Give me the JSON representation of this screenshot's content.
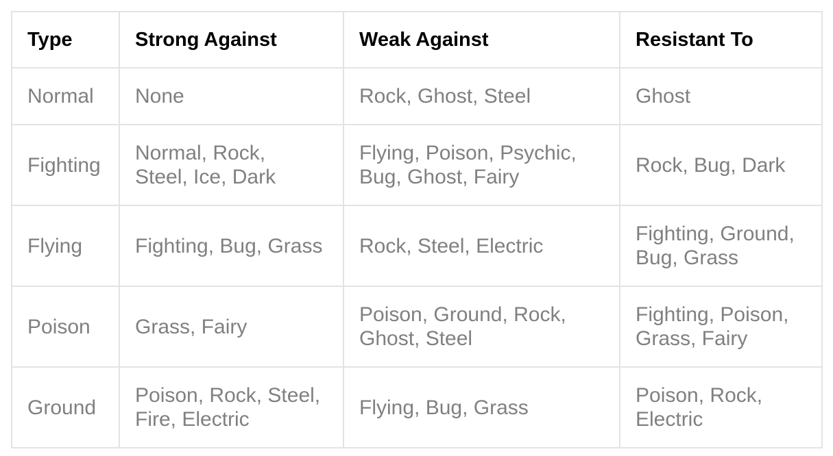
{
  "table": {
    "headers": [
      "Type",
      "Strong Against",
      "Weak Against",
      "Resistant To"
    ],
    "rows": [
      {
        "type": "Normal",
        "strong": [
          "None"
        ],
        "weak": [
          "Rock, Ghost, Steel"
        ],
        "resistant": [
          "Ghost"
        ]
      },
      {
        "type": "Fighting",
        "strong": [
          "Normal, Rock,",
          "Steel, Ice, Dark"
        ],
        "weak": [
          "Flying, Poison, Psychic,",
          "Bug, Ghost, Fairy"
        ],
        "resistant": [
          "Rock, Bug, Dark"
        ]
      },
      {
        "type": "Flying",
        "strong": [
          "Fighting, Bug, Grass"
        ],
        "weak": [
          "Rock, Steel, Electric"
        ],
        "resistant": [
          "Fighting, Ground,",
          "Bug, Grass"
        ]
      },
      {
        "type": "Poison",
        "strong": [
          "Grass, Fairy"
        ],
        "weak": [
          "Poison, Ground, Rock,",
          "Ghost, Steel"
        ],
        "resistant": [
          "Fighting, Poison,",
          "Grass, Fairy"
        ]
      },
      {
        "type": "Ground",
        "strong": [
          "Poison, Rock, Steel,",
          "Fire, Electric"
        ],
        "weak": [
          "Flying, Bug, Grass"
        ],
        "resistant": [
          "Poison, Rock,",
          "Electric"
        ]
      }
    ]
  }
}
